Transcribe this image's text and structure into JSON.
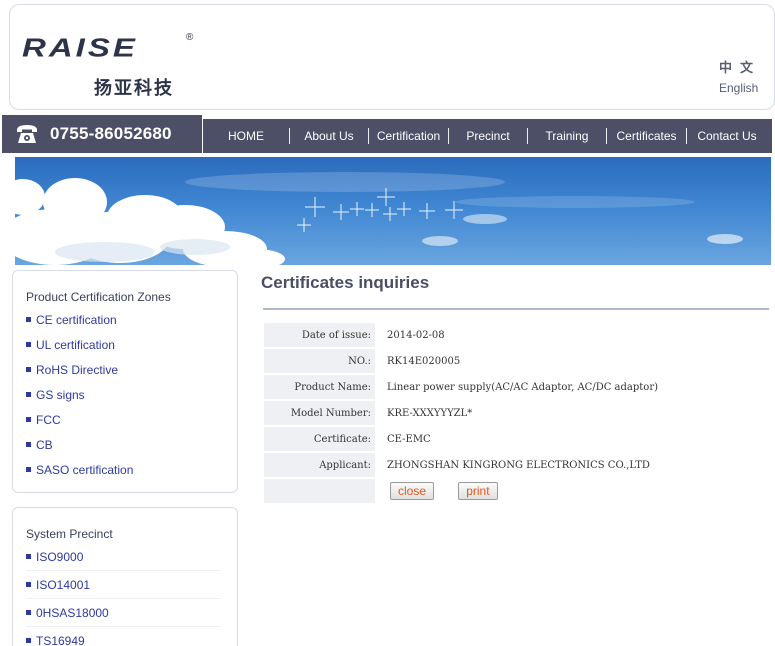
{
  "brand": {
    "logo_text": "RAISE",
    "logo_reg": "®",
    "logo_cn": "扬亚科技",
    "lang_cn": "中文",
    "lang_en": "English"
  },
  "phone": {
    "number": "0755-86052680",
    "icon": "phone-icon"
  },
  "nav": [
    {
      "label": "HOME"
    },
    {
      "label": "About Us"
    },
    {
      "label": "Certification"
    },
    {
      "label": "Precinct"
    },
    {
      "label": "Training"
    },
    {
      "label": "Certificates"
    },
    {
      "label": "Contact Us"
    }
  ],
  "sidebar": {
    "product_zone": {
      "title": "Product Certification Zones",
      "items": [
        {
          "label": "CE certification"
        },
        {
          "label": "UL certification"
        },
        {
          "label": "RoHS Directive"
        },
        {
          "label": "GS signs"
        },
        {
          "label": "FCC"
        },
        {
          "label": "CB"
        },
        {
          "label": "SASO certification"
        }
      ]
    },
    "system_precinct": {
      "title": "System Precinct",
      "items": [
        {
          "label": "ISO9000"
        },
        {
          "label": "ISO14001"
        },
        {
          "label": "0HSAS18000"
        },
        {
          "label": "TS16949"
        }
      ]
    }
  },
  "content": {
    "title": "Certificates inquiries",
    "rows": [
      {
        "label": "Date of issue:",
        "value": "2014-02-08"
      },
      {
        "label": "NO.:",
        "value": "RK14E020005"
      },
      {
        "label": "Product Name:",
        "value": "Linear power supply(AC/AC Adaptor, AC/DC adaptor)"
      },
      {
        "label": "Model Number:",
        "value": "KRE-XXXYYYZL*"
      },
      {
        "label": "Certificate:",
        "value": "CE-EMC"
      },
      {
        "label": "Applicant:",
        "value": "ZHONGSHAN KINGRONG ELECTRONICS CO.,LTD"
      }
    ],
    "buttons": {
      "close": "close",
      "print": "print"
    }
  },
  "colors": {
    "nav_bg": "#4c4f66",
    "link_blue": "#2e3aa0",
    "button_text": "#e2561c",
    "label_bg": "#eef0f3"
  }
}
